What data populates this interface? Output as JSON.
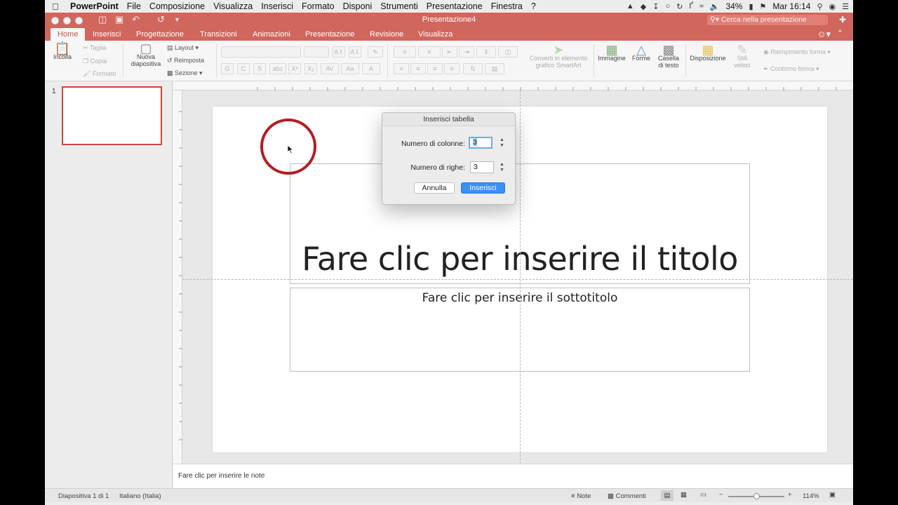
{
  "menubar": {
    "app_name": "PowerPoint",
    "items": [
      "File",
      "Composizione",
      "Visualizza",
      "Inserisci",
      "Formato",
      "Disponi",
      "Strumenti",
      "Presentazione",
      "Finestra",
      "?"
    ],
    "battery": "34%",
    "clock": "Mar 16:14"
  },
  "titlebar": {
    "document_title": "Presentazione4",
    "search_placeholder": "Cerca nella presentazione"
  },
  "tabs": [
    "Home",
    "Inserisci",
    "Progettazione",
    "Transizioni",
    "Animazioni",
    "Presentazione",
    "Revisione",
    "Visualizza"
  ],
  "ribbon": {
    "paste": "Incolla",
    "cut": "Taglia",
    "copy": "Copia",
    "format_painter": "Formato",
    "new_slide_line1": "Nuova",
    "new_slide_line2": "diapositiva",
    "layout": "Layout",
    "reset": "Reimposta",
    "section": "Sezione",
    "smartart_line1": "Converti in elemento",
    "smartart_line2": "grafico SmartArt",
    "picture": "Immagine",
    "shapes": "Forme",
    "textbox_line1": "Casella",
    "textbox_line2": "di testo",
    "arrange": "Disposizione",
    "quick_styles_line1": "Stili",
    "quick_styles_line2": "veloci",
    "shape_fill": "Riempimento forma",
    "shape_outline": "Contorno forma"
  },
  "slides_panel": {
    "slide_number": "1"
  },
  "slide": {
    "title_placeholder": "Fare clic per inserire il titolo",
    "subtitle_placeholder": "Fare clic per inserire il sottotitolo"
  },
  "notes": {
    "placeholder": "Fare clic per inserire le note"
  },
  "statusbar": {
    "slide_info": "Diapositiva 1 di 1",
    "language": "Italiano (Italia)",
    "notes_btn": "Note",
    "comments_btn": "Commenti",
    "zoom": "114%",
    "zoom_level": 0.5
  },
  "dialog": {
    "title": "Inserisci tabella",
    "columns_label": "Numero di colonne:",
    "columns_value": "3",
    "rows_label": "Numero di righe:",
    "rows_value": "3",
    "cancel": "Annulla",
    "ok": "Inserisci"
  },
  "colors": {
    "accent": "#d0665c",
    "primary_button": "#3b8ff5",
    "highlight_circle": "#b31c22"
  }
}
